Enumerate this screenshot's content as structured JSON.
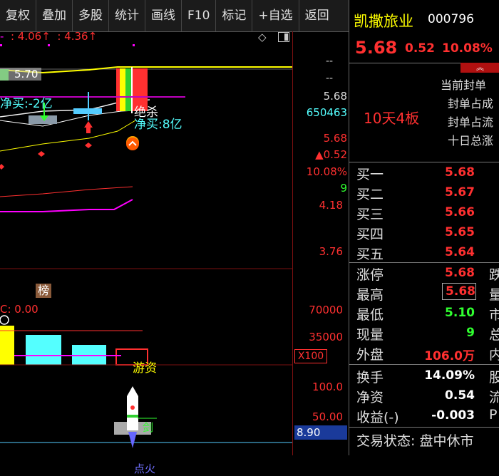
{
  "toolbar": {
    "items": [
      "复权",
      "叠加",
      "多股",
      "统计",
      "画线",
      "F10",
      "标记",
      "+自选",
      "返回"
    ]
  },
  "chart": {
    "top_indicator": {
      "dash": "-",
      "v1": "4.06",
      "v2": "4.36",
      "arrow": "↑"
    },
    "price_axis": [
      "5.68",
      "650463",
      "5.68",
      "▲0.52",
      "10.08%",
      "9",
      "4.18",
      "3.76"
    ],
    "ma_label": "5.70",
    "annotations": {
      "net_buy": "净买:-2亿",
      "net_buy2": "净买:8亿",
      "kill": "绝杀",
      "bang": "榜"
    },
    "vol_indicator": "C: 0.00",
    "vol_axis": [
      "70000",
      "35000"
    ],
    "vol_multiplier": "X100",
    "youzi": "游资",
    "osc_axis": [
      "100.0",
      "50.00"
    ],
    "osc_labels": {
      "sword": "剑",
      "ignite": "点火"
    },
    "cursor_value": "8.90",
    "colors": {
      "up": "#ff3030",
      "down": "#54ffff",
      "ma_yellow": "#ffff00",
      "ma_magenta": "#ff00ff"
    }
  },
  "stock": {
    "name": "凯撒旅业",
    "code": "000796",
    "price": "5.68",
    "change": "0.52",
    "change_pct": "10.08%",
    "board_tag": "10天4板",
    "seal_info": [
      "当前封单",
      "封单占成",
      "封单占流",
      "十日总涨"
    ]
  },
  "order_book": {
    "bids": [
      {
        "label": "买一",
        "price": "5.68"
      },
      {
        "label": "买二",
        "price": "5.67"
      },
      {
        "label": "买三",
        "price": "5.66"
      },
      {
        "label": "买四",
        "price": "5.65"
      },
      {
        "label": "买五",
        "price": "5.64"
      }
    ]
  },
  "stats": {
    "rows": [
      {
        "label": "涨停",
        "value": "5.68",
        "color": "#ff3030",
        "cut": "跌"
      },
      {
        "label": "最高",
        "value": "5.68",
        "color": "#ff3030",
        "cut": "量"
      },
      {
        "label": "最低",
        "value": "5.10",
        "color": "#30ff30",
        "cut": "市"
      },
      {
        "label": "现量",
        "value": "9",
        "color": "#30ff30",
        "cut": "总"
      },
      {
        "label": "外盘",
        "value": "106.0万",
        "color": "#ff3030",
        "cut": "内"
      }
    ]
  },
  "fundamentals": {
    "rows": [
      {
        "label": "换手",
        "value": "14.09%",
        "cut": "股"
      },
      {
        "label": "净资",
        "value": "0.54",
        "cut": "流"
      },
      {
        "label": "收益(-)",
        "value": "-0.003",
        "cut": "P"
      }
    ]
  },
  "status": {
    "text": "交易状态: 盘中休市"
  }
}
